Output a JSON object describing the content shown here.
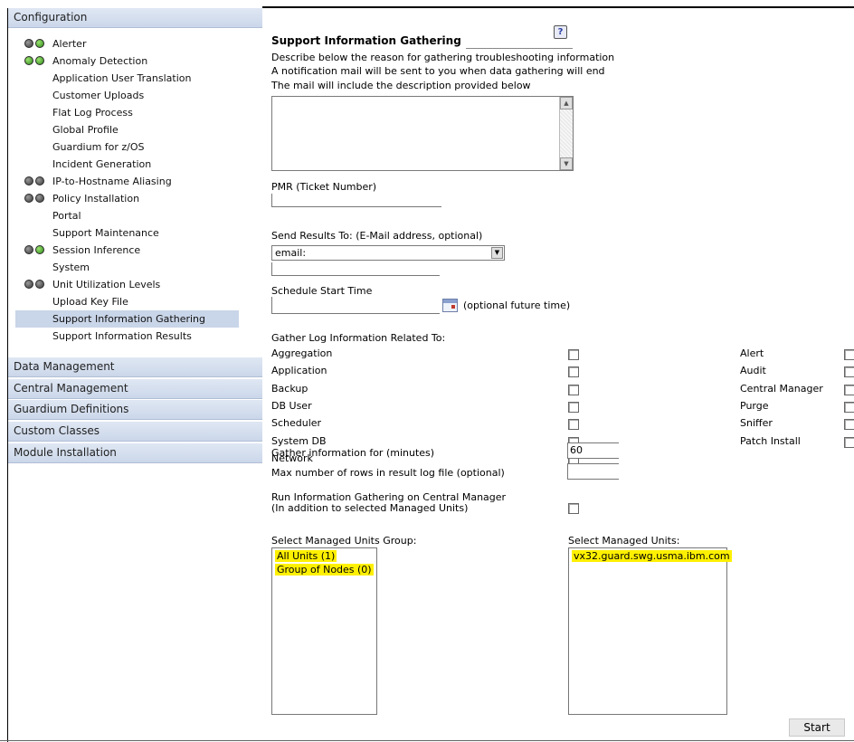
{
  "sidebar": {
    "configuration_header": "Configuration",
    "items": [
      {
        "label": "Alerter",
        "leds": [
          "off",
          "green"
        ],
        "selected": false
      },
      {
        "label": "Anomaly Detection",
        "leds": [
          "green",
          "green"
        ],
        "selected": false
      },
      {
        "label": "Application User Translation",
        "leds": [],
        "selected": false
      },
      {
        "label": "Customer Uploads",
        "leds": [],
        "selected": false
      },
      {
        "label": "Flat Log Process",
        "leds": [],
        "selected": false
      },
      {
        "label": "Global Profile",
        "leds": [],
        "selected": false
      },
      {
        "label": "Guardium for z/OS",
        "leds": [],
        "selected": false
      },
      {
        "label": "Incident Generation",
        "leds": [],
        "selected": false
      },
      {
        "label": "IP-to-Hostname Aliasing",
        "leds": [
          "off",
          "off"
        ],
        "selected": false
      },
      {
        "label": "Policy Installation",
        "leds": [
          "off",
          "off"
        ],
        "selected": false
      },
      {
        "label": "Portal",
        "leds": [],
        "selected": false
      },
      {
        "label": "Support Maintenance",
        "leds": [],
        "selected": false
      },
      {
        "label": "Session Inference",
        "leds": [
          "off",
          "green"
        ],
        "selected": false
      },
      {
        "label": "System",
        "leds": [],
        "selected": false
      },
      {
        "label": "Unit Utilization Levels",
        "leds": [
          "off",
          "off"
        ],
        "selected": false
      },
      {
        "label": "Upload Key File",
        "leds": [],
        "selected": false
      },
      {
        "label": "Support Information Gathering",
        "leds": [],
        "selected": true
      },
      {
        "label": "Support Information Results",
        "leds": [],
        "selected": false
      }
    ],
    "sections": [
      {
        "label": "Data Management"
      },
      {
        "label": "Central Management"
      },
      {
        "label": "Guardium Definitions"
      },
      {
        "label": "Custom Classes"
      },
      {
        "label": "Module Installation"
      }
    ]
  },
  "main": {
    "title": "Support Information Gathering",
    "help_icon": "help-icon",
    "description_lines": [
      "Describe below the reason for gathering troubleshooting information",
      "A notification mail will be sent to you when data gathering will end",
      "The mail will include the description provided below"
    ],
    "description_value": "",
    "pmr_label": "PMR (Ticket Number)",
    "pmr_value": "",
    "send_results_label": "Send Results To: (E-Mail address, optional)",
    "send_results_select": "email:",
    "send_results_value": "",
    "schedule_label": "Schedule Start Time",
    "schedule_value": "",
    "schedule_hint": "(optional future time)",
    "gather_log_label": "Gather Log Information Related To:",
    "log_options_left": [
      "Aggregation",
      "Application",
      "Backup",
      "DB User",
      "Scheduler",
      "System DB",
      "Network"
    ],
    "log_options_right": [
      "Alert",
      "Audit",
      "Central Manager",
      "Purge",
      "Sniffer",
      "Patch Install"
    ],
    "gather_minutes_label": "Gather information for (minutes)",
    "gather_minutes_value": "60",
    "max_rows_label": "Max number of rows in result log file (optional)",
    "max_rows_value": "",
    "run_cm_label_1": "Run Information Gathering on Central Manager",
    "run_cm_label_2": "(In addition to selected Managed Units)",
    "managed_group_label": "Select Managed Units Group:",
    "managed_groups": [
      "All Units (1)",
      "Group of Nodes (0)"
    ],
    "managed_units_label": "Select Managed Units:",
    "managed_units": [
      "vx32.guard.swg.usma.ibm.com"
    ],
    "start_button": "Start",
    "highlight_color": "#fff000"
  }
}
